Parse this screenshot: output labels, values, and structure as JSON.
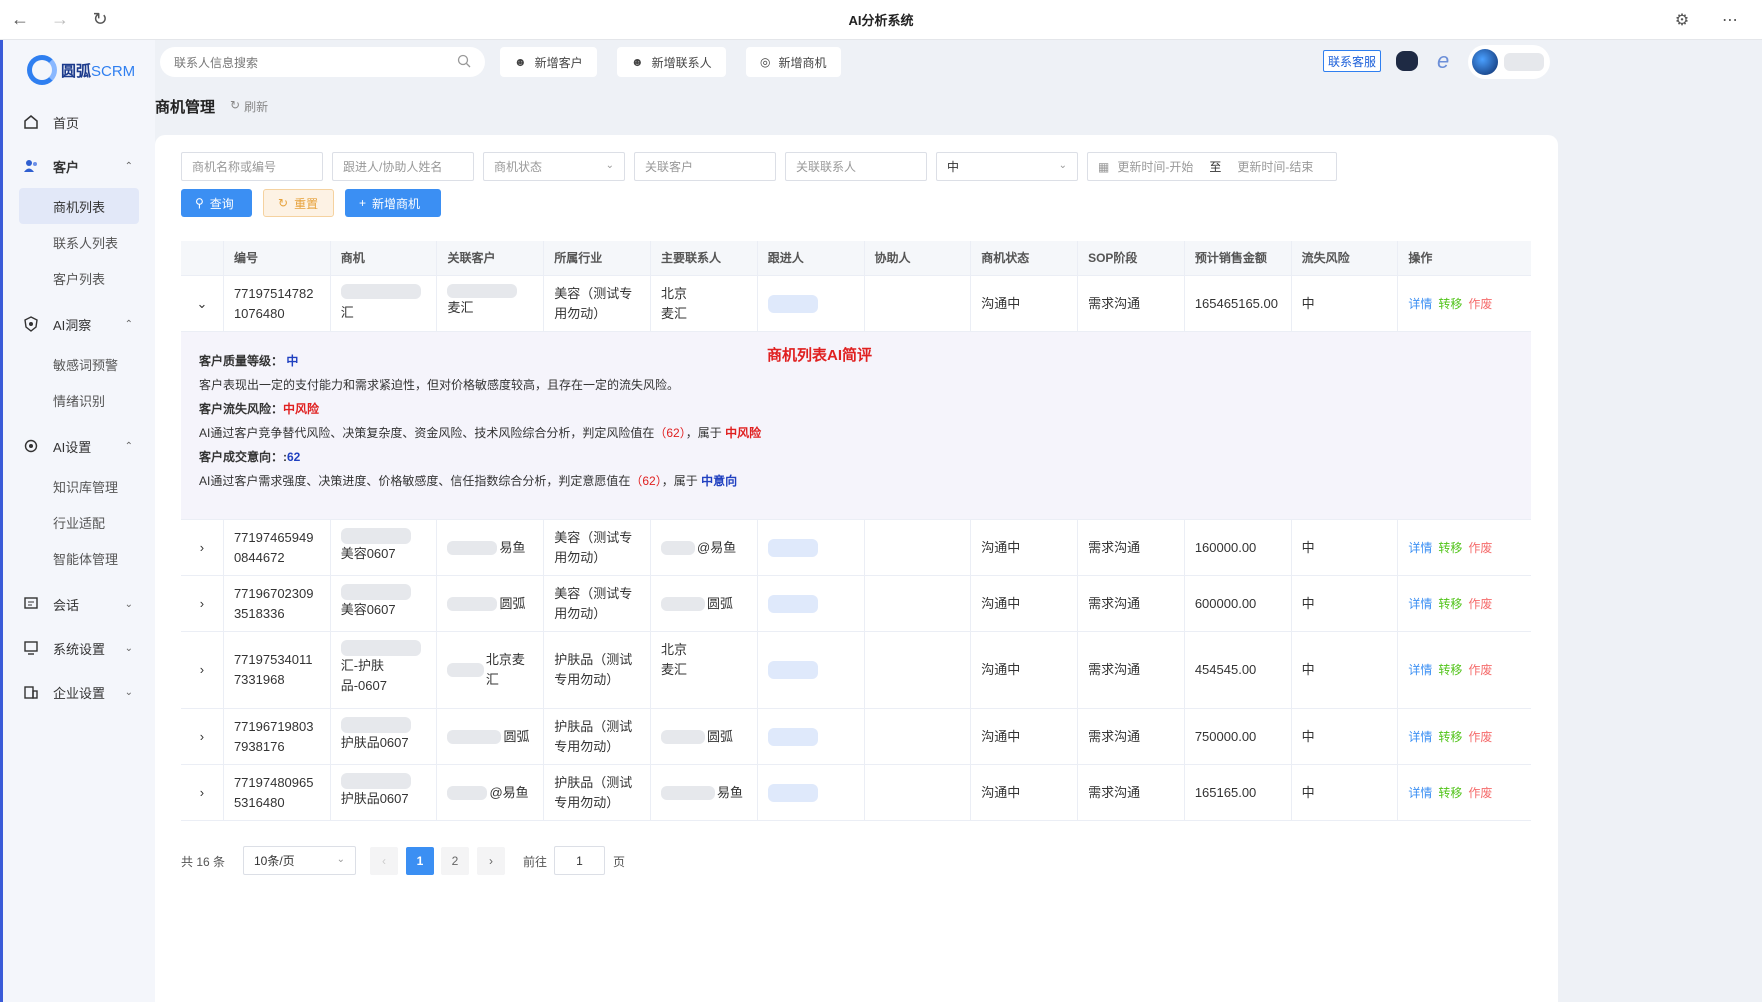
{
  "window": {
    "title": "AI分析系统"
  },
  "app": {
    "logo_main": "圆弧",
    "logo_sub": "SCRM"
  },
  "sidebar": {
    "home": "首页",
    "customer": "客户",
    "customer_items": [
      "商机列表",
      "联系人列表",
      "客户列表"
    ],
    "insight": "AI洞察",
    "insight_items": [
      "敏感词预警",
      "情绪识别"
    ],
    "aiset": "AI设置",
    "aiset_items": [
      "知识库管理",
      "行业适配",
      "智能体管理"
    ],
    "session": "会话",
    "system": "系统设置",
    "enterprise": "企业设置"
  },
  "header": {
    "search_placeholder": "联系人信息搜索",
    "btn_add_customer": "新增客户",
    "btn_add_contact": "新增联系人",
    "btn_add_opportunity": "新增商机",
    "service": "联系客服"
  },
  "page": {
    "title": "商机管理",
    "refresh": "刷新"
  },
  "filters": {
    "name": "商机名称或编号",
    "follower": "跟进人/协助人姓名",
    "status": "商机状态",
    "customer": "关联客户",
    "contact": "关联联系人",
    "risk_value": "中",
    "date_start": "更新时间-开始",
    "date_sep": "至",
    "date_end": "更新时间-结束",
    "query": "查询",
    "reset": "重置",
    "add": "新增商机"
  },
  "table": {
    "headers": [
      "编号",
      "商机",
      "关联客户",
      "所属行业",
      "主要联系人",
      "跟进人",
      "协助人",
      "商机状态",
      "SOP阶段",
      "预计销售金额",
      "流失风险",
      "操作"
    ],
    "actions": {
      "detail": "详情",
      "transfer": "转移",
      "void": "作废"
    },
    "rows": [
      {
        "id": "77197514782 1076480",
        "opp": "汇",
        "customer": "麦汇",
        "industry": "美容（测试专用勿动）",
        "contact_a": "北京",
        "contact_b": "麦汇",
        "status": "沟通中",
        "sop": "需求沟通",
        "amount": "165465165.00",
        "risk": "中"
      },
      {
        "id": "77197465949 0844672",
        "opp": "美容0607",
        "customer": "易鱼",
        "industry": "美容（测试专用勿动）",
        "contact_a": "@易鱼",
        "contact_b": "",
        "status": "沟通中",
        "sop": "需求沟通",
        "amount": "160000.00",
        "risk": "中"
      },
      {
        "id": "77196702309 3518336",
        "opp": "美容0607",
        "customer": "圆弧",
        "industry": "美容（测试专用勿动）",
        "contact_a": "圆弧",
        "contact_b": "",
        "status": "沟通中",
        "sop": "需求沟通",
        "amount": "600000.00",
        "risk": "中"
      },
      {
        "id": "77197534011 7331968",
        "opp": "汇-护肤品-0607",
        "customer": "北京麦汇",
        "industry": "护肤品（测试专用勿动）",
        "contact_a": "北京",
        "contact_b": "麦汇",
        "status": "沟通中",
        "sop": "需求沟通",
        "amount": "454545.00",
        "risk": "中"
      },
      {
        "id": "77196719803 7938176",
        "opp": "护肤品0607",
        "customer": "圆弧",
        "industry": "护肤品（测试专用勿动）",
        "contact_a": "圆弧",
        "contact_b": "",
        "status": "沟通中",
        "sop": "需求沟通",
        "amount": "750000.00",
        "risk": "中"
      },
      {
        "id": "77197480965 5316480",
        "opp": "护肤品0607",
        "customer": "@易鱼",
        "industry": "护肤品（测试专用勿动）",
        "contact_a": "易鱼",
        "contact_b": "",
        "status": "沟通中",
        "sop": "需求沟通",
        "amount": "165165.00",
        "risk": "中"
      }
    ]
  },
  "ai_review": {
    "title": "商机列表AI简评",
    "quality_label": "客户质量等级：",
    "quality_value": "中",
    "quality_desc": "客户表现出一定的支付能力和需求紧迫性，但对价格敏感度较高，且存在一定的流失风险。",
    "churn_label": "客户流失风险：",
    "churn_value": "中风险",
    "churn_desc_a": "AI通过客户竞争替代风险、决策复杂度、资金风险、技术风险综合分析，判定风险值在",
    "churn_score": "（62）",
    "churn_desc_b": "，属于",
    "churn_level": "中风险",
    "intent_label": "客户成交意向：:",
    "intent_value": "62",
    "intent_desc_a": "AI通过客户需求强度、决策进度、价格敏感度、信任指数综合分析，判定意愿值在",
    "intent_score": "（62）",
    "intent_desc_b": "，属于",
    "intent_level": "中意向"
  },
  "pagination": {
    "total": "共 16 条",
    "page_size": "10条/页",
    "pages": [
      "1",
      "2"
    ],
    "goto_label": "前往",
    "goto_value": "1",
    "page_suffix": "页"
  }
}
